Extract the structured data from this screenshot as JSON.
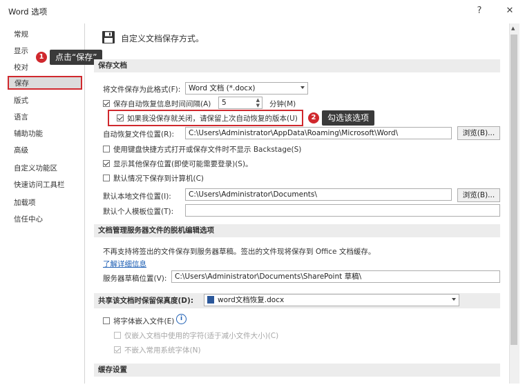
{
  "window": {
    "title": "Word 选项",
    "help": "?",
    "close": "✕"
  },
  "sidebar": {
    "items": [
      {
        "label": "常规"
      },
      {
        "label": "显示"
      },
      {
        "label": "校对"
      },
      {
        "label": "保存"
      },
      {
        "label": "版式"
      },
      {
        "label": "语言"
      },
      {
        "label": "辅助功能"
      },
      {
        "label": "高级"
      },
      {
        "label": "自定义功能区"
      },
      {
        "label": "快速访问工具栏"
      },
      {
        "label": "加载项"
      },
      {
        "label": "信任中心"
      }
    ],
    "selected": "保存"
  },
  "header": {
    "title": "自定义文档保存方式。",
    "icon": "save-icon"
  },
  "sections": {
    "save_docs": "保存文档",
    "offline": "文档管理服务器文件的脱机编辑选项",
    "fidelity_label": "共享该文档时保留保真度(D):",
    "cache": "缓存设置"
  },
  "save": {
    "format_label": "将文件保存为此格式(F):",
    "format_value": "Word 文档 (*.docx)",
    "autorecover_label": "保存自动恢复信息时间间隔(A)",
    "autorecover_minutes": "5",
    "minutes_label": "分钟(M)",
    "keep_last_label": "如果我没保存就关闭，请保留上次自动恢复的版本(U)",
    "autorecover_location_label": "自动恢复文件位置(R):",
    "autorecover_location_value": "C:\\Users\\Administrator\\AppData\\Roaming\\Microsoft\\Word\\",
    "browse1": "浏览(B)...",
    "backstage_label": "使用键盘快捷方式打开或保存文件时不显示 Backstage(S)",
    "show_locations_label": "显示其他保存位置(即使可能需要登录)(S)。",
    "default_computer_label": "默认情况下保存到计算机(C)",
    "default_local_label": "默认本地文件位置(I):",
    "default_local_value": "C:\\Users\\Administrator\\Documents\\",
    "browse2": "浏览(B)...",
    "personal_template_label": "默认个人模板位置(T):",
    "personal_template_value": ""
  },
  "offline": {
    "note": "不再支持将签出的文件保存到服务器草稿。签出的文件现将保存到 Office 文档缓存。",
    "learn_more": "了解详细信息",
    "drafts_label": "服务器草稿位置(V):",
    "drafts_value": "C:\\Users\\Administrator\\Documents\\SharePoint 草稿\\"
  },
  "fidelity": {
    "doc_value": "word文档恢复.docx",
    "embed_fonts_label": "将字体嵌入文件(E)",
    "embed_used_label": "仅嵌入文档中使用的字符(适于减小文件大小)(C)",
    "no_common_label": "不嵌入常用系统字体(N)"
  },
  "callouts": {
    "one_num": "1",
    "one_text": "点击“保存”",
    "two_num": "2",
    "two_text": "勾选该选项"
  },
  "colors": {
    "accent_red": "#d0282d",
    "callout_bg": "#3a3a3a",
    "link": "#1e5fb4"
  }
}
